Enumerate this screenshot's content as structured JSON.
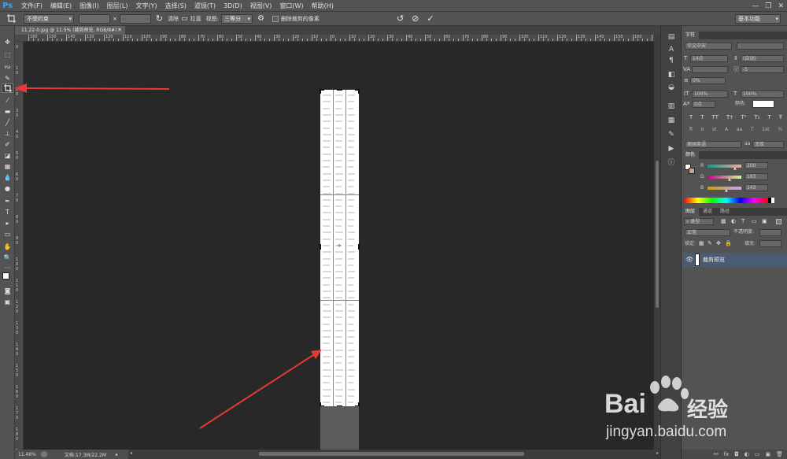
{
  "app": {
    "logo": "Ps"
  },
  "menubar": {
    "items": [
      "文件(F)",
      "编辑(E)",
      "图像(I)",
      "图层(L)",
      "文字(Y)",
      "选择(S)",
      "滤镜(T)",
      "3D(D)",
      "视图(V)",
      "窗口(W)",
      "帮助(H)"
    ]
  },
  "window_controls": {
    "minimize": "—",
    "restore": "❐",
    "close": "✕"
  },
  "options_bar": {
    "ratio_select": "不受约束",
    "swap_symbol": "×",
    "clear_label": "清除",
    "straighten_label": "拉直",
    "view_label": "视图:",
    "view_select": "三等分",
    "delete_pixels_label": "删除裁剪的像素",
    "workspace_select": "基本功能"
  },
  "document": {
    "tab_title": "11.22-0.jpg @ 11.5% (裁剪预览, RGB/8#) *",
    "tab_close": "×"
  },
  "rulers": {
    "top_labels": [
      "160",
      "150",
      "140",
      "130",
      "120",
      "110",
      "100",
      "90",
      "80",
      "70",
      "60",
      "50",
      "40",
      "30",
      "20",
      "10",
      "0",
      "10",
      "20",
      "30",
      "40",
      "50",
      "60",
      "70",
      "80",
      "90",
      "100",
      "110",
      "120",
      "130",
      "140",
      "150",
      "160",
      "170"
    ],
    "left_labels": [
      "0",
      "1\n0",
      "2\n0",
      "3\n0",
      "4\n0",
      "5\n0",
      "6\n0",
      "7\n0",
      "8\n0",
      "9\n0",
      "1\n0\n0",
      "1\n1\n0",
      "1\n2\n0",
      "1\n3\n0",
      "1\n4\n0",
      "1\n5\n0",
      "1\n6\n0",
      "1\n7\n0",
      "1\n8\n0",
      "1\n9\n0"
    ]
  },
  "status": {
    "zoom": "11.46%",
    "doc_info": "文档:17.3M/22.2M"
  },
  "character_panel": {
    "tab": "字符",
    "font_family": "华文中宋",
    "font_style": "-",
    "size": "14点",
    "leading": "(自动)",
    "kerning": "",
    "tracking": "-5",
    "vertical_scale": "100%",
    "horizontal_scale": "100%",
    "baseline_shift": "0点",
    "color_label": "颜色:",
    "percent_0": "0%",
    "type_buttons": [
      "T",
      "T",
      "TT",
      "Tт",
      "T¹",
      "T₁",
      "T",
      "Ŧ"
    ],
    "ot_buttons": [
      "fi",
      "σ",
      "st",
      "A",
      "aa",
      "T",
      "1st",
      "½"
    ],
    "language": "美国英语",
    "antialias_prefix": "aa",
    "antialias": "浑厚"
  },
  "color_panel": {
    "tab": "颜色",
    "r_label": "R",
    "g_label": "G",
    "b_label": "B",
    "r": "200",
    "g": "163",
    "b": "143"
  },
  "layers_panel": {
    "tabs": [
      "图层",
      "通道",
      "路径"
    ],
    "filter_kind": "类型",
    "blend_mode": "正常",
    "opacity_label": "不透明度:",
    "lock_label": "锁定:",
    "fill_label": "填充:",
    "layers": [
      {
        "name": "裁剪预览",
        "visible": true,
        "selected": true
      }
    ],
    "footer_icons": [
      "⚯",
      "fx",
      "◘",
      "◐",
      "▭",
      "▣",
      "🗑"
    ]
  },
  "watermark": {
    "brand": "Bai",
    "brand_tail": "经验",
    "url": "jingyan.baidu.com"
  },
  "colors": {
    "ui_bg": "#535353",
    "canvas_bg": "#282828",
    "arrow": "#e53935",
    "layer_selected": "#4b5c72",
    "ps_blue": "#31a8ff"
  }
}
